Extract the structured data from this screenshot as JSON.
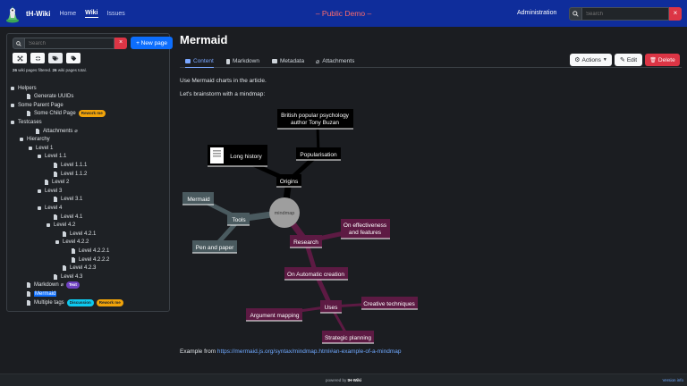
{
  "app": {
    "brand": "tH-Wiki",
    "demo_title": "– Public Demo –",
    "admin_link": "Administration"
  },
  "nav": {
    "home": "Home",
    "wiki": "Wiki",
    "issues": "Issues"
  },
  "nav_search": {
    "placeholder": "Search",
    "clear": "×"
  },
  "sidebar": {
    "search_placeholder": "Search",
    "clear": "×",
    "new_page_button": "+ New page",
    "stats": {
      "filtered": "26",
      "filtered_label": " wiki pages filtered. ",
      "total": "26",
      "total_label": " wiki pages total."
    },
    "tree": [
      {
        "label": "Helpers"
      },
      {
        "label": "Generate UUIDs"
      },
      {
        "label": "Some Parent Page"
      },
      {
        "label": "Some Child Page",
        "badge": "Rework me"
      },
      {
        "label": "Testcases"
      },
      {
        "label": "Attachments",
        "suffix": "⌀"
      },
      {
        "label": "Hierarchy"
      },
      {
        "label": "Level 1"
      },
      {
        "label": "Level 1.1"
      },
      {
        "label": "Level 1.1.1"
      },
      {
        "label": "Level 1.1.2"
      },
      {
        "label": "Level 2"
      },
      {
        "label": "Level 3"
      },
      {
        "label": "Level 3.1"
      },
      {
        "label": "Level 4"
      },
      {
        "label": "Level 4.1"
      },
      {
        "label": "Level 4.2"
      },
      {
        "label": "Level 4.2.1"
      },
      {
        "label": "Level 4.2.2"
      },
      {
        "label": "Level 4.2.2.1"
      },
      {
        "label": "Level 4.2.2.2"
      },
      {
        "label": "Level 4.2.3"
      },
      {
        "label": "Level 4.3"
      },
      {
        "label": "Markdown",
        "suffix": "⌀",
        "badge": "Text"
      },
      {
        "label": "Mermaid"
      },
      {
        "label": "Multiple tags",
        "badge": "Discussion",
        "badge2": "Rework me"
      }
    ]
  },
  "page": {
    "title": "Mermaid",
    "tabs": {
      "content": "Content",
      "markdown": "Markdown",
      "metadata": "Metadata",
      "attachments": "Attachments"
    },
    "actions": "Actions",
    "edit": "Edit",
    "delete": "Delete",
    "intro": "Use Mermaid charts in the article.",
    "brainstorm": "Let's brainstorm with a mindmap:",
    "example_prefix": "Example from ",
    "example_link": "https://mermaid.js.org/syntax/mindmap.html#an-example-of-a-mindmap"
  },
  "mindmap": {
    "root": "mindmap",
    "origins": "Origins",
    "long_history": "Long history",
    "popularisation": "Popularisation",
    "british_1": "British popular psychology",
    "british_2": "author Tony Buzan",
    "research": "Research",
    "effectiveness_1": "On effectiveness",
    "effectiveness_2": "and features",
    "automatic": "On Automatic creation",
    "uses": "Uses",
    "creative": "Creative techniques",
    "strategic": "Strategic planning",
    "argument": "Argument mapping",
    "tools": "Tools",
    "pen_paper": "Pen and paper",
    "mermaid": "Mermaid",
    "colors": {
      "origins": "#000000",
      "research": "#5d1a43",
      "tools": "#4a5a5f",
      "root": "#9e9e9e"
    }
  },
  "footer": {
    "powered_prefix": "powered by ",
    "powered_brand": "tH-Wiki",
    "version": "Version info"
  }
}
